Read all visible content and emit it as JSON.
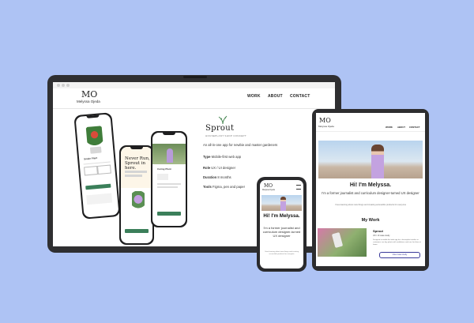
{
  "laptop": {
    "logo": "MO",
    "name": "Melyssa Ojeda",
    "nav": [
      "WORK",
      "ABOUT",
      "CONTACT"
    ],
    "project_title": "Sprout",
    "project_subtitle": "HOUSEPLANT SHOP CONCEPT",
    "project_desc": "An all-in-one app for newbie and master gardeners",
    "details": [
      {
        "label": "Type",
        "value": "Mobile-first web app"
      },
      {
        "label": "Role",
        "value": "UX / UI designer"
      },
      {
        "label": "Duration",
        "value": "8 months"
      },
      {
        "label": "Tools",
        "value": "Figma, pen and paper"
      }
    ],
    "phone_center_headline": "Never Run, Sprout in here.",
    "phone_left_title": "Snake Plant",
    "phone_right_title": "Caring Plant"
  },
  "tablet": {
    "logo": "MO",
    "name": "Melyssa Ojeda",
    "nav": [
      "WORK",
      "ABOUT",
      "CONTACT"
    ],
    "hero_title": "Hi! I'm Melyssa.",
    "hero_sub": "I'm a former journalist and curriculum designer-turned UX designer",
    "hero_small": "I love learning about new things and creating accessible products for everyone",
    "section_title": "My Work",
    "card_title": "Sprout",
    "card_sub": "UX / UI case study",
    "card_desc": "Designed a mobile-first web app for a houseplant retailer so customers can buy plants with confidence and care for them at home.",
    "card_button": "View case study"
  },
  "small_phone": {
    "logo": "MO",
    "name": "Melyssa Ojeda",
    "hero_title": "Hi! I'm Melyssa.",
    "hero_sub": "I'm a former journalist and curriculum designer-turned UX designer",
    "hero_small": "I love learning about new things and creating accessible products for everyone"
  },
  "colors": {
    "background": "#aec3f4",
    "device_frame": "#2f2f31",
    "accent_green": "#3b7f5a",
    "accent_blue": "#3a3a9a"
  }
}
